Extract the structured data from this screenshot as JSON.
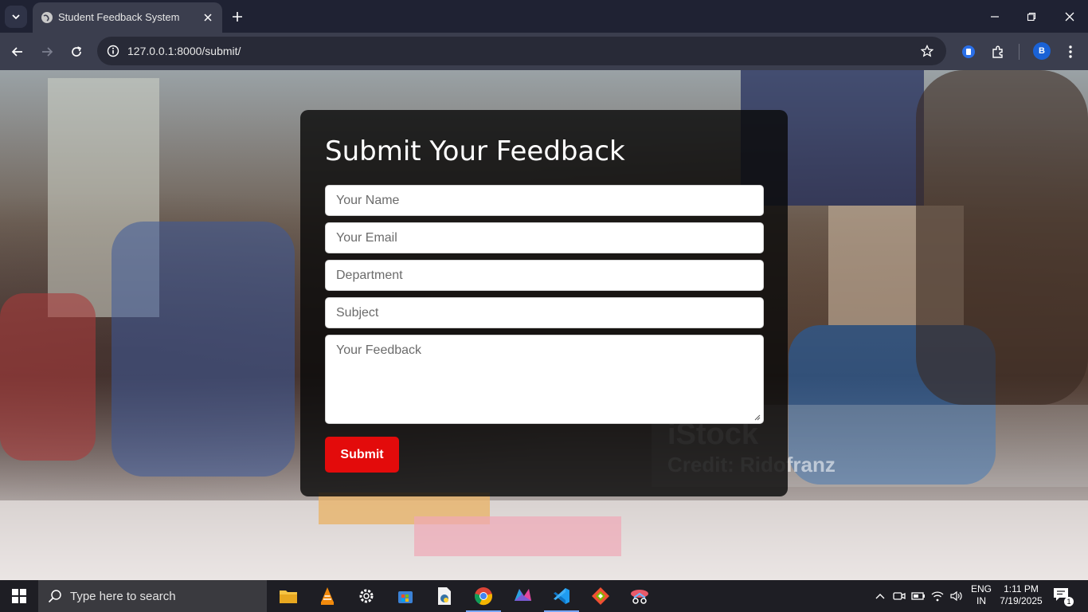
{
  "browser": {
    "tab_title": "Student Feedback System",
    "url": "127.0.0.1:8000/submit/",
    "profile_initial": "B"
  },
  "page": {
    "title": "Submit Your Feedback",
    "fields": {
      "name_placeholder": "Your Name",
      "email_placeholder": "Your Email",
      "department_placeholder": "Department",
      "subject_placeholder": "Subject",
      "feedback_placeholder": "Your Feedback"
    },
    "submit_label": "Submit",
    "watermark": {
      "brand": "iStock",
      "credit": "Credit: Ridofranz"
    }
  },
  "taskbar": {
    "search_placeholder": "Type here to search",
    "language": "ENG",
    "region": "IN",
    "time": "1:11 PM",
    "date": "7/19/2025",
    "notification_count": "1"
  },
  "colors": {
    "submit_button": "#e30b0b",
    "browser_frame": "#1f2233",
    "toolbar": "#3b3e4e",
    "card": "rgba(10,10,10,0.82)"
  }
}
